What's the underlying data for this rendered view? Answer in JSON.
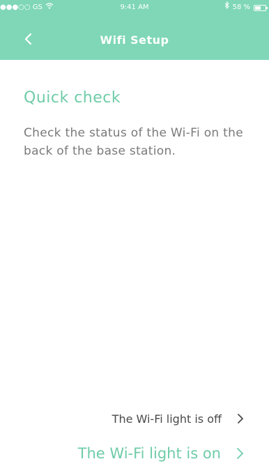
{
  "status_bar": {
    "carrier": "●●●○○ GS",
    "time": "9:41 AM",
    "battery_percent": "58 %",
    "battery_level": 0.58,
    "icons": [
      "wifi-signal-icon",
      "bluetooth-icon",
      "battery-icon"
    ]
  },
  "nav": {
    "title": "Wifi Setup",
    "back_icon": "chevron-left-icon"
  },
  "content": {
    "title": "Quick check",
    "description": "Check the status of the Wi-Fi on the back of the base station."
  },
  "options": [
    {
      "label": "The Wi-Fi light is off",
      "icon": "chevron-right-icon"
    },
    {
      "label": "The Wi-Fi light is on",
      "icon": "chevron-right-icon"
    }
  ],
  "colors": {
    "accent": "#7fd7b8",
    "accent_text": "#6fcca9",
    "body_text": "#7a7a7a",
    "dark_text": "#4a4a4a"
  }
}
